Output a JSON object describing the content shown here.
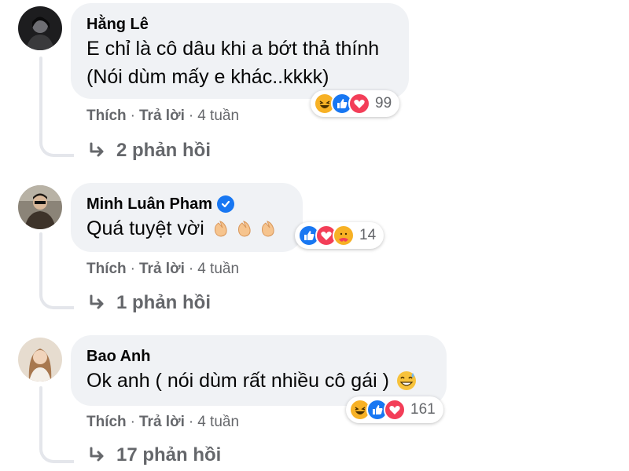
{
  "comments": [
    {
      "author": "Hằng Lê",
      "verified": false,
      "lines": [
        "E chỉ là cô dâu khi a bớt thả thính",
        "(Nói dùm mấy e khác..kkkk)"
      ],
      "reactions": [
        "haha",
        "like",
        "love"
      ],
      "reaction_count": "99",
      "like_label": "Thích",
      "reply_label": "Trả lời",
      "time": "4 tuần",
      "replies": "2 phản hồi"
    },
    {
      "author": "Minh Luân Pham",
      "verified": true,
      "lines": [
        "Quá tuyệt vời"
      ],
      "reactions": [
        "like",
        "love",
        "care"
      ],
      "reaction_count": "14",
      "like_label": "Thích",
      "reply_label": "Trả lời",
      "time": "4 tuần",
      "replies": "1 phản hồi"
    },
    {
      "author": "Bao Anh",
      "verified": false,
      "lines": [
        "Ok anh ( nói dùm rất nhiều cô gái )"
      ],
      "reactions": [
        "haha",
        "like",
        "love"
      ],
      "reaction_count": "161",
      "like_label": "Thích",
      "reply_label": "Trả lời",
      "time": "4 tuần",
      "replies": "17 phản hồi"
    }
  ],
  "colors": {
    "bubble": "#f0f2f5",
    "like": "#1877f2",
    "love": "#f33e58",
    "haha": "#f7b125",
    "secondary_text": "#65676b"
  },
  "icons": [
    "reply-arrow-icon",
    "verified-badge-icon",
    "clapping-hands-icon",
    "grinning-sweat-icon"
  ]
}
